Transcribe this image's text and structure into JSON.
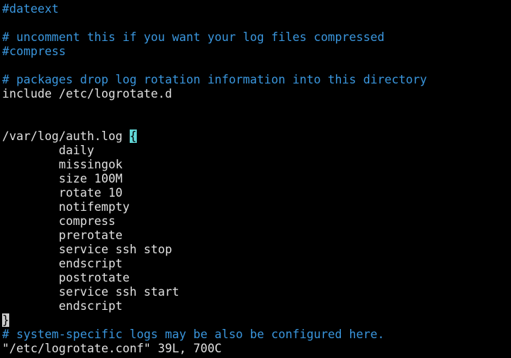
{
  "editor": {
    "lines": [
      {
        "text": "#dateext",
        "kind": "comment"
      },
      {
        "text": "",
        "kind": "code"
      },
      {
        "text": "# uncomment this if you want your log files compressed",
        "kind": "comment"
      },
      {
        "text": "#compress",
        "kind": "comment"
      },
      {
        "text": "",
        "kind": "code"
      },
      {
        "text": "# packages drop log rotation information into this directory",
        "kind": "comment"
      },
      {
        "text": "include /etc/logrotate.d",
        "kind": "code"
      },
      {
        "text": "",
        "kind": "code"
      },
      {
        "text": "",
        "kind": "code"
      },
      {
        "text": "/var/log/auth.log ",
        "kind": "code",
        "highlight": "{",
        "highlight_kind": "cursor"
      },
      {
        "text": "        daily",
        "kind": "code"
      },
      {
        "text": "        missingok",
        "kind": "code"
      },
      {
        "text": "        size 100M",
        "kind": "code"
      },
      {
        "text": "        rotate 10",
        "kind": "code"
      },
      {
        "text": "        notifempty",
        "kind": "code"
      },
      {
        "text": "        compress",
        "kind": "code"
      },
      {
        "text": "        prerotate",
        "kind": "code"
      },
      {
        "text": "        service ssh stop",
        "kind": "code"
      },
      {
        "text": "        endscript",
        "kind": "code"
      },
      {
        "text": "        postrotate",
        "kind": "code"
      },
      {
        "text": "        service ssh start",
        "kind": "code"
      },
      {
        "text": "        endscript",
        "kind": "code"
      },
      {
        "text": "",
        "kind": "code",
        "highlight": "}",
        "highlight_kind": "bracematch"
      },
      {
        "text": "# system-specific logs may be also be configured here.",
        "kind": "comment"
      }
    ]
  },
  "status_bar": {
    "message": "\"/etc/logrotate.conf\" 39L, 700C"
  },
  "colors": {
    "background": "#000000",
    "comment": "#3a96dd",
    "text": "#e0e0e0",
    "cursor": "#61d6d6",
    "bracematch": "#cccccc"
  }
}
